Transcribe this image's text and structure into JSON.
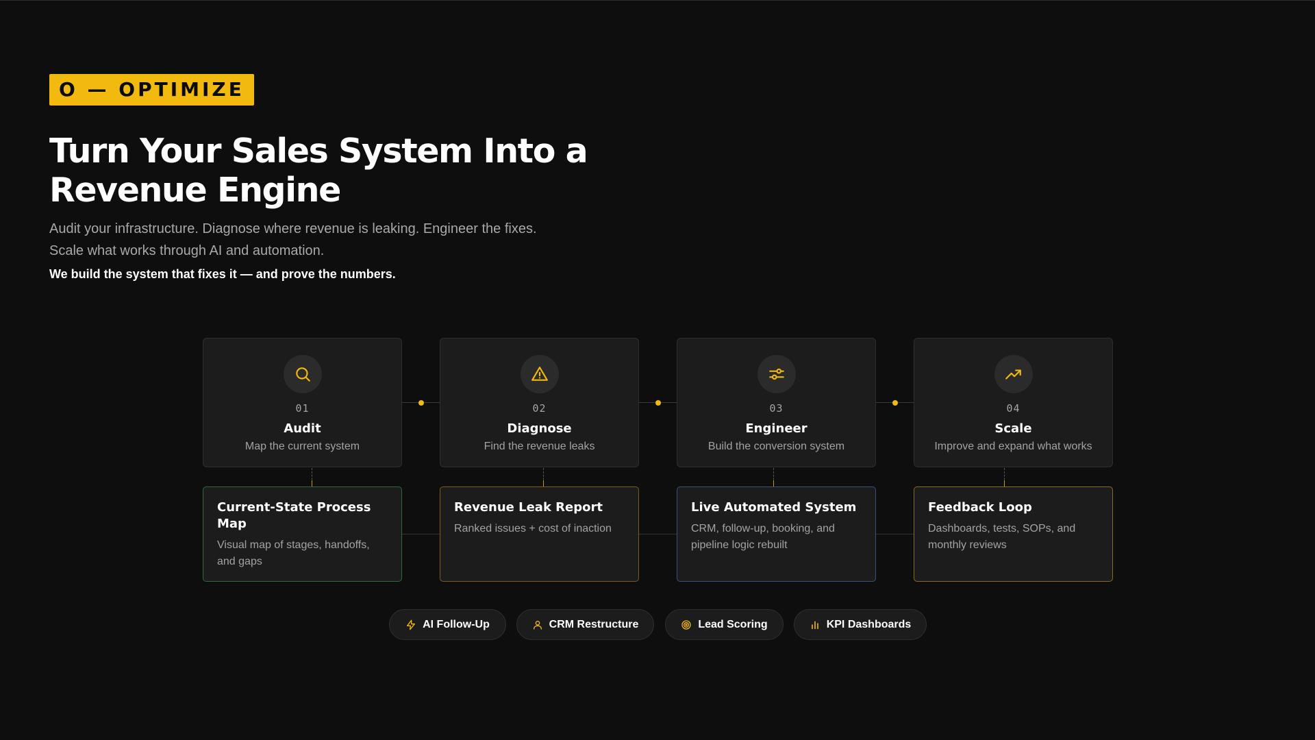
{
  "badge": {
    "label": "O — OPTIMIZE"
  },
  "hero": {
    "title": "Turn Your Sales System Into a Revenue Engine",
    "lead_line_1": "Audit your infrastructure. Diagnose where revenue is leaking. Engineer the fixes.",
    "lead_line_2": "Scale what works through AI and automation.",
    "emphasis": "We build the system that fixes it — and prove the numbers."
  },
  "steps": [
    {
      "number": "01",
      "title": "Audit",
      "description": "Map the current system",
      "icon": "search-icon"
    },
    {
      "number": "02",
      "title": "Diagnose",
      "description": "Find the revenue leaks",
      "icon": "warning-icon"
    },
    {
      "number": "03",
      "title": "Engineer",
      "description": "Build the conversion system",
      "icon": "sliders-icon"
    },
    {
      "number": "04",
      "title": "Scale",
      "description": "Improve and expand what works",
      "icon": "trending-up-icon"
    }
  ],
  "deliverables": [
    {
      "title": "Current-State Process Map",
      "description": "Visual map of stages, handoffs, and gaps",
      "border_color": "#2f6a3a"
    },
    {
      "title": "Revenue Leak Report",
      "description": "Ranked issues + cost of inaction",
      "border_color": "#7d5a1c"
    },
    {
      "title": "Live Automated System",
      "description": "CRM, follow-up, booking, and pipeline logic rebuilt",
      "border_color": "#3b4f7d"
    },
    {
      "title": "Feedback Loop",
      "description": "Dashboards, tests, SOPs, and monthly reviews",
      "border_color": "#8a6a1c"
    }
  ],
  "pills": [
    {
      "label": "AI Follow-Up",
      "icon": "lightning-icon"
    },
    {
      "label": "CRM Restructure",
      "icon": "user-icon"
    },
    {
      "label": "Lead Scoring",
      "icon": "target-icon"
    },
    {
      "label": "KPI Dashboards",
      "icon": "bar-chart-icon"
    }
  ],
  "colors": {
    "background": "#0e0e0e",
    "card": "#1c1c1c",
    "accent": "#f2b90f",
    "text": "#ffffff",
    "muted": "#a3a3a3"
  }
}
